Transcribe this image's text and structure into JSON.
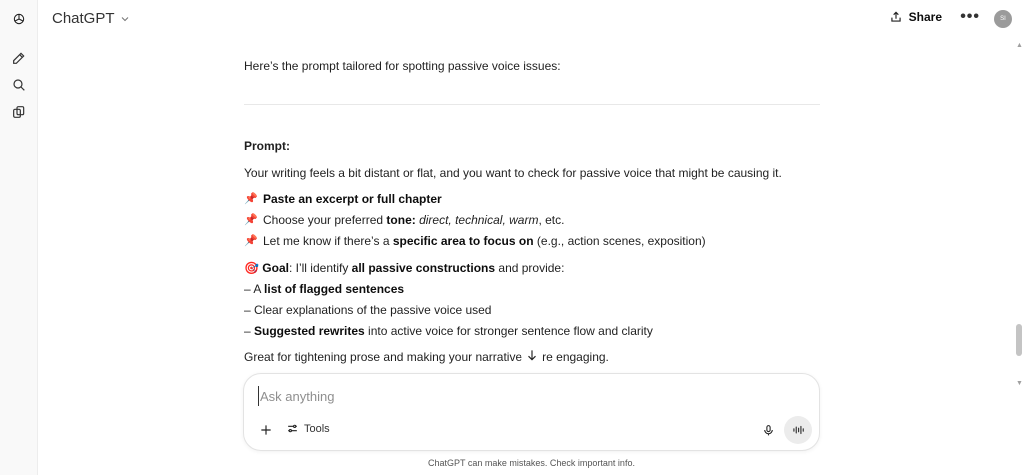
{
  "header": {
    "model_name": "ChatGPT",
    "share_label": "Share",
    "more_label": "•••",
    "avatar_initials": "SI"
  },
  "sidebar": {
    "icons": [
      "openai-logo-icon",
      "new-chat-icon",
      "search-icon",
      "library-icon"
    ]
  },
  "message": {
    "intro": "Here’s the prompt tailored for spotting passive voice issues:",
    "prompt_label": "Prompt:",
    "paragraph": "Your writing feels a bit distant or flat, and you want to check for passive voice that might be causing it.",
    "bullets": [
      {
        "pin": "📌",
        "bold": "Paste an excerpt or full chapter"
      },
      {
        "pin": "📌",
        "pre": "Choose your preferred ",
        "bold": "tone:",
        "italic": " direct, technical, warm",
        "post": ", etc."
      },
      {
        "pin": "📌",
        "pre": "Let me know if there’s a ",
        "bold": "specific area to focus on",
        "post": " (e.g., action scenes, exposition)"
      }
    ],
    "goal": {
      "emoji": "🎯",
      "bold1": "Goal",
      "text1": ": I’ll identify ",
      "bold2": "all passive constructions",
      "text2": " and provide:"
    },
    "dash_items": [
      {
        "pre": "– A ",
        "bold": "list of flagged sentences",
        "post": ""
      },
      {
        "pre": "– Clear explanations of the passive voice used",
        "bold": "",
        "post": ""
      },
      {
        "pre": "– ",
        "bold": "Suggested rewrites",
        "post": " into active voice for stronger sentence flow and clarity"
      }
    ],
    "closing": "Great for tightening prose and making your narrative more engaging."
  },
  "composer": {
    "placeholder": "Ask anything",
    "tools_label": "Tools"
  },
  "footer": {
    "note": "ChatGPT can make mistakes. Check important info."
  }
}
